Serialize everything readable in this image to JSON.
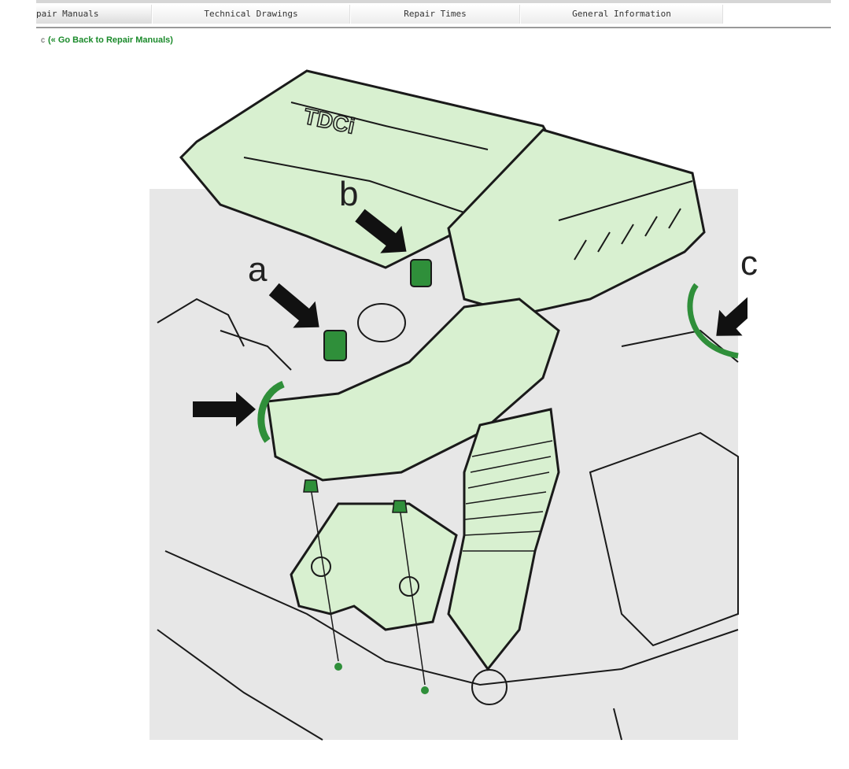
{
  "tabs": [
    {
      "label": "pair Manuals",
      "active": true
    },
    {
      "label": "Technical Drawings",
      "active": false
    },
    {
      "label": "Repair Times",
      "active": false
    },
    {
      "label": "General Information",
      "active": false
    }
  ],
  "back_link": {
    "prefix": "c",
    "label": "(« Go Back to Repair Manuals)"
  },
  "diagram": {
    "engine_cover_text": "TDCi",
    "callouts": [
      "a",
      "b",
      "c"
    ]
  },
  "colors": {
    "highlight_fill": "#d8f0d0",
    "highlight_dark": "#2f8f3a",
    "link_green": "#1a8a2a",
    "line": "#1a1a1a"
  }
}
